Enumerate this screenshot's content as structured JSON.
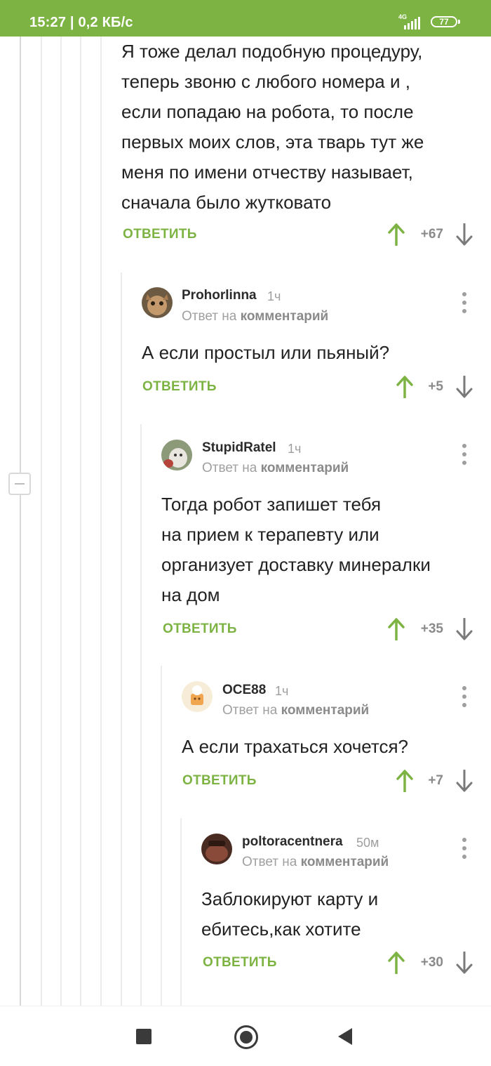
{
  "status_bar": {
    "time_speed": "15:27 | 0,2 КБ/с",
    "network": "4G",
    "battery": "77"
  },
  "comments": [
    {
      "text": "Я тоже делал подобную процедуру,\nтеперь звоню с любого номера и ,\nесли попадаю на робота, то после\nпервых моих слов, эта тварь тут же\nменя по имени отчеству называет,\nсначала было жутковато",
      "reply_label": "ОТВЕТИТЬ",
      "score": "+67"
    },
    {
      "author": "Prohorlinna",
      "time": "1ч",
      "reply_to_prefix": "Ответ на",
      "reply_to_target": "комментарий",
      "text": "А если простыл или пьяный?",
      "reply_label": "ОТВЕТИТЬ",
      "score": "+5"
    },
    {
      "author": "StupidRatel",
      "time": "1ч",
      "reply_to_prefix": "Ответ на",
      "reply_to_target": "комментарий",
      "text": "Тогда робот запишет тебя\nна прием к терапевту или\nорганизует доставку минералки\nна дом",
      "reply_label": "ОТВЕТИТЬ",
      "score": "+35"
    },
    {
      "author": "OCE88",
      "time": "1ч",
      "reply_to_prefix": "Ответ на",
      "reply_to_target": "комментарий",
      "text": "А если трахаться хочется?",
      "reply_label": "ОТВЕТИТЬ",
      "score": "+7"
    },
    {
      "author": "poltoracentnera",
      "time": "50м",
      "reply_to_prefix": "Ответ на",
      "reply_to_target": "комментарий",
      "text": "Заблокируют карту и\nебитесь,как хотите",
      "reply_label": "ОТВЕТИТЬ",
      "score": "+30"
    }
  ],
  "colors": {
    "accent": "#7cb342",
    "text": "#222222",
    "muted": "#9e9e9e"
  },
  "icons": [
    "signal-icon",
    "battery-icon",
    "upvote-arrow-icon",
    "downvote-arrow-icon",
    "more-menu-icon",
    "collapse-thread-icon",
    "recents-icon",
    "home-icon",
    "back-icon"
  ]
}
